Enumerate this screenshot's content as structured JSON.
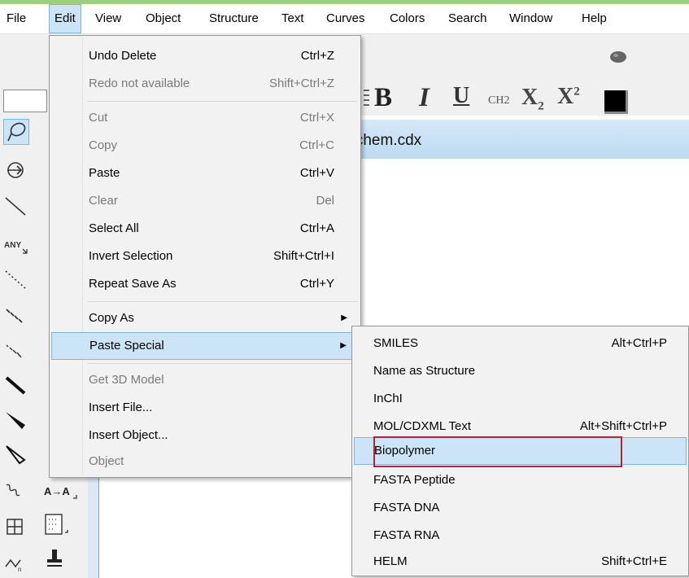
{
  "menubar": {
    "items": [
      "File",
      "Edit",
      "View",
      "Object",
      "Structure",
      "Text",
      "Curves",
      "Colors",
      "Search",
      "Window",
      "Help"
    ],
    "active": "Edit"
  },
  "document": {
    "title": "chem.cdx"
  },
  "text_toolbar": {
    "bold": "B",
    "italic": "I",
    "underline": "U",
    "formula": "CH2",
    "subscript": "X",
    "subscript_digit": "2",
    "superscript": "X",
    "superscript_digit": "2"
  },
  "edit_menu": {
    "items": [
      {
        "label": "Undo Delete",
        "shortcut": "Ctrl+Z"
      },
      {
        "label": "Redo not available",
        "shortcut": "Shift+Ctrl+Z"
      },
      {
        "label": "Cut",
        "shortcut": "Ctrl+X"
      },
      {
        "label": "Copy",
        "shortcut": "Ctrl+C"
      },
      {
        "label": "Paste",
        "shortcut": "Ctrl+V"
      },
      {
        "label": "Clear",
        "shortcut": "Del"
      },
      {
        "label": "Select All",
        "shortcut": "Ctrl+A"
      },
      {
        "label": "Invert Selection",
        "shortcut": "Shift+Ctrl+I"
      },
      {
        "label": "Repeat Save As",
        "shortcut": "Ctrl+Y"
      },
      {
        "label": "Copy As",
        "shortcut": ""
      },
      {
        "label": "Paste Special",
        "shortcut": ""
      },
      {
        "label": "Get 3D Model",
        "shortcut": ""
      },
      {
        "label": "Insert File...",
        "shortcut": ""
      },
      {
        "label": "Insert Object...",
        "shortcut": ""
      },
      {
        "label": "Object",
        "shortcut": ""
      }
    ]
  },
  "paste_special_menu": {
    "items": [
      {
        "label": "SMILES",
        "shortcut": "Alt+Ctrl+P"
      },
      {
        "label": "Name as Structure",
        "shortcut": ""
      },
      {
        "label": "InChI",
        "shortcut": ""
      },
      {
        "label": "MOL/CDXML Text",
        "shortcut": "Alt+Shift+Ctrl+P"
      },
      {
        "label": "Biopolymer",
        "shortcut": ""
      },
      {
        "label": "FASTA Peptide",
        "shortcut": ""
      },
      {
        "label": "FASTA DNA",
        "shortcut": ""
      },
      {
        "label": "FASTA RNA",
        "shortcut": ""
      },
      {
        "label": "HELM",
        "shortcut": "Shift+Ctrl+E"
      }
    ],
    "highlighted": "Biopolymer"
  },
  "tools": {
    "any_label": "ANY",
    "a_to_a": "A→A"
  },
  "colors": {
    "highlight": "#cce4f7",
    "highlight_border": "#7fb5dd",
    "annotation_red": "#b8232b",
    "title_bar": "#c9e1f5"
  }
}
